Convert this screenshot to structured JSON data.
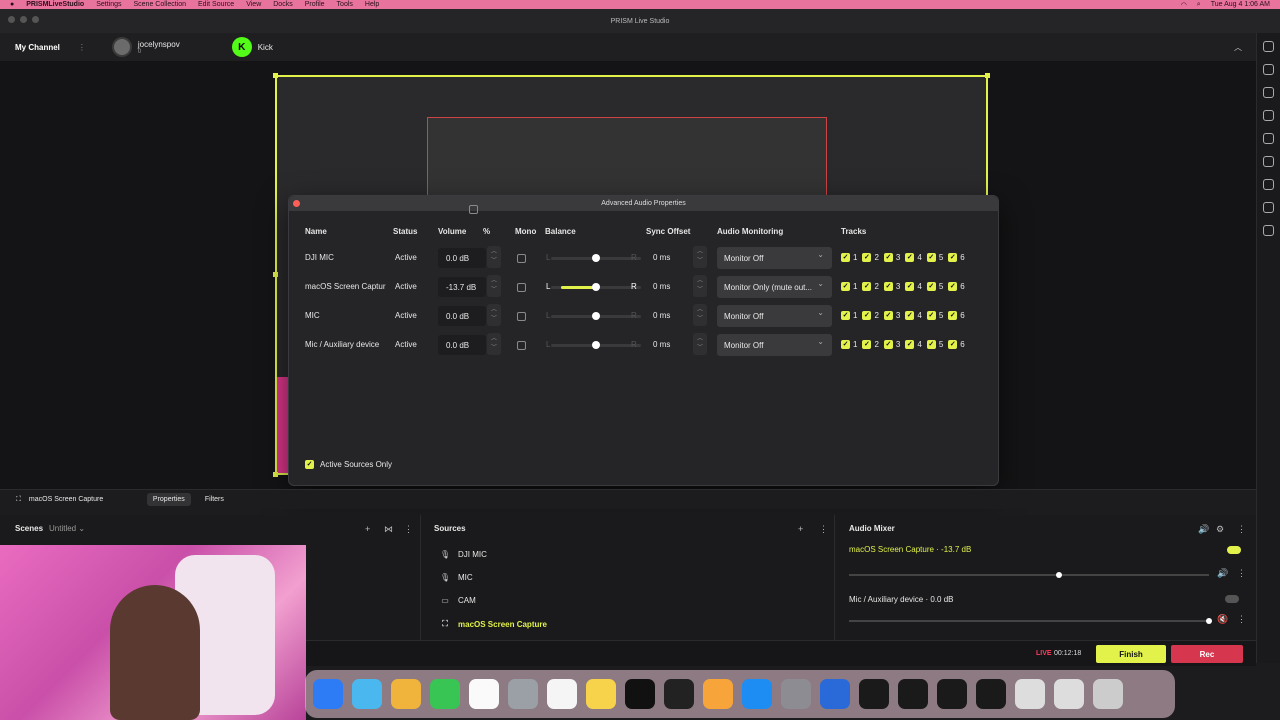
{
  "menubar": {
    "app": "PRISMLiveStudio",
    "items": [
      "Settings",
      "Scene Collection",
      "Edit Source",
      "View",
      "Docks",
      "Profile",
      "Tools",
      "Help"
    ],
    "clock": "Tue Aug 4  1:06 AM"
  },
  "window": {
    "title": "PRISM Live Studio"
  },
  "channel": {
    "title": "My Channel",
    "account1": "jocelynspov",
    "account1_sub": "0",
    "account2": "Kick"
  },
  "dialog": {
    "title": "Advanced Audio Properties",
    "headers": {
      "name": "Name",
      "status": "Status",
      "volume": "Volume",
      "pct": "%",
      "mono": "Mono",
      "balance": "Balance",
      "sync": "Sync Offset",
      "monitoring": "Audio Monitoring",
      "tracks": "Tracks"
    },
    "rows": [
      {
        "name": "DJI MIC",
        "status": "Active",
        "volume": "0.0 dB",
        "sync": "0 ms",
        "monitoring": "Monitor Off",
        "balance": 0.5
      },
      {
        "name": "macOS Screen Captur",
        "status": "Active",
        "volume": "-13.7 dB",
        "sync": "0 ms",
        "monitoring": "Monitor Only (mute out...",
        "balance": 0.5
      },
      {
        "name": "MIC",
        "status": "Active",
        "volume": "0.0 dB",
        "sync": "0 ms",
        "monitoring": "Monitor Off",
        "balance": 0.5
      },
      {
        "name": "Mic / Auxiliary device",
        "status": "Active",
        "volume": "0.0 dB",
        "sync": "0 ms",
        "monitoring": "Monitor Off",
        "balance": 0.5
      }
    ],
    "track_labels": [
      "1",
      "2",
      "3",
      "4",
      "5",
      "6"
    ],
    "balance_l": "L",
    "balance_r": "R",
    "active_only": "Active Sources Only"
  },
  "sourcebar": {
    "selected": "macOS Screen Capture",
    "properties": "Properties",
    "filters": "Filters"
  },
  "scenes": {
    "title": "Scenes",
    "collection": "Untitled"
  },
  "sources": {
    "title": "Sources",
    "items": [
      "DJI MIC",
      "MIC",
      "CAM",
      "macOS Screen Capture"
    ]
  },
  "mixer": {
    "title": "Audio Mixer",
    "channels": [
      {
        "name": "macOS Screen Capture",
        "level": "-13.7 dB"
      },
      {
        "name": "Mic / Auxiliary device",
        "level": "0.0 dB"
      }
    ]
  },
  "bottom": {
    "live": "LIVE",
    "time": "00:12:18",
    "finish": "Finish",
    "rec": "Rec"
  },
  "colors": {
    "accent": "#e2f24a",
    "rec": "#d6374e",
    "menubar": "#e8739c"
  }
}
